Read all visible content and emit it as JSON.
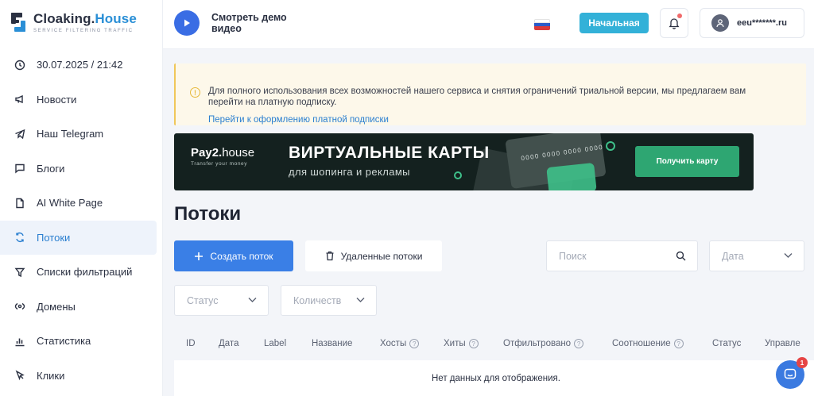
{
  "logo": {
    "title_main": "Cloaking.",
    "title_accent": "House",
    "subtitle": "SERVICE FILTERING TRAFFIC"
  },
  "sidebar": {
    "items": [
      {
        "label": "30.07.2025 / 21:42",
        "icon": "clock-icon"
      },
      {
        "label": "Новости",
        "icon": "megaphone-icon"
      },
      {
        "label": "Наш Telegram",
        "icon": "telegram-icon"
      },
      {
        "label": "Блоги",
        "icon": "chat-icon"
      },
      {
        "label": "AI White Page",
        "icon": "document-icon"
      },
      {
        "label": "Потоки",
        "icon": "flows-icon",
        "active": true
      },
      {
        "label": "Списки фильтраций",
        "icon": "filter-icon"
      },
      {
        "label": "Домены",
        "icon": "domain-icon"
      },
      {
        "label": "Статистика",
        "icon": "chart-icon"
      },
      {
        "label": "Клики",
        "icon": "cursor-icon"
      }
    ]
  },
  "header": {
    "demo_label": "Смотреть демо видео",
    "home_button": "Начальная",
    "user_email": "eeu*******.ru"
  },
  "alert": {
    "text": "Для полного использования всех возможностей нашего сервиса и снятия ограничений триальной версии, мы предлагаем вам перейти на платную подписку.",
    "link": "Перейти к оформлению платной подписки"
  },
  "banner": {
    "brand_main": "Pay2.",
    "brand_accent": "house",
    "brand_tagline": "Transfer your money",
    "title": "ВИРТУАЛЬНЫЕ КАРТЫ",
    "subtitle": "для шопинга и рекламы",
    "card_number": "0000 0000 0000 0000",
    "button": "Получить карту"
  },
  "page": {
    "title": "Потоки"
  },
  "toolbar": {
    "create": "Создать поток",
    "deleted": "Удаленные потоки",
    "search_placeholder": "Поиск",
    "date_placeholder": "Дата",
    "status_placeholder": "Статус",
    "count_placeholder": "Количеств"
  },
  "table": {
    "columns": [
      "ID",
      "Дата",
      "Label",
      "Название",
      "Хосты",
      "Хиты",
      "Отфильтровано",
      "Соотношение",
      "Статус",
      "Управле"
    ],
    "empty": "Нет данных для отображения."
  },
  "chat": {
    "badge": "1"
  },
  "colors": {
    "accent": "#3a7fe6",
    "home_button": "#33b1d8",
    "banner_bg": "#14211f",
    "banner_button": "#2ea672",
    "alert_bg": "#fdf8ea"
  }
}
